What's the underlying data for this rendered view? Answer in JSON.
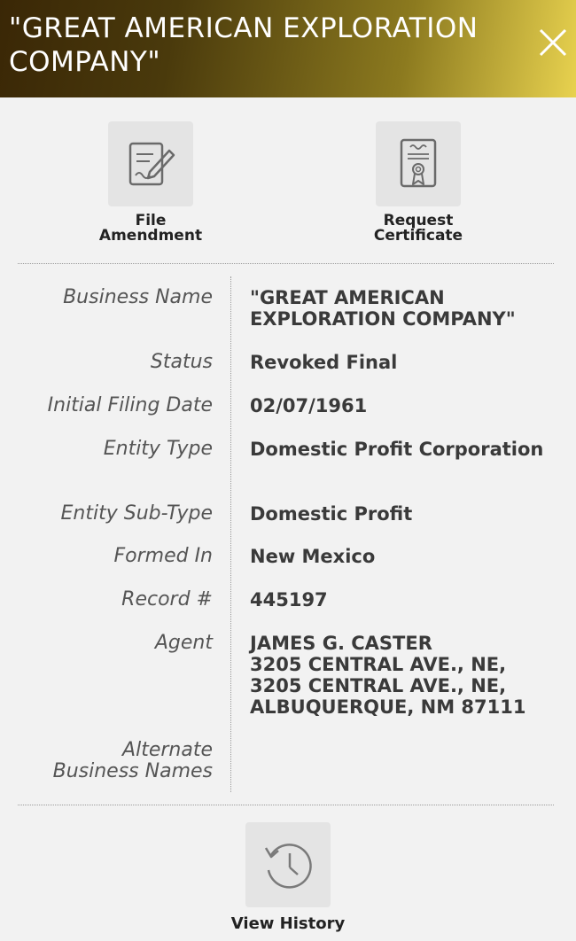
{
  "header": {
    "title": "\"GREAT AMERICAN EXPLORATION COMPANY\"",
    "close_icon": "close-icon"
  },
  "actions": {
    "file_amendment": {
      "label_line1": "File",
      "label_line2": "Amendment",
      "icon": "document-edit-icon"
    },
    "request_certificate": {
      "label_line1": "Request",
      "label_line2": "Certificate",
      "icon": "certificate-icon"
    }
  },
  "details": {
    "business_name": {
      "label": "Business Name",
      "value": "\"GREAT AMERICAN EXPLORATION COMPANY\""
    },
    "status": {
      "label": "Status",
      "value": "Revoked Final"
    },
    "initial_filing_date": {
      "label": "Initial Filing Date",
      "value": "02/07/1961"
    },
    "entity_type": {
      "label": "Entity Type",
      "value": "Domestic Profit Corporation"
    },
    "entity_sub_type": {
      "label": "Entity Sub-Type",
      "value": "Domestic Profit"
    },
    "formed_in": {
      "label": "Formed In",
      "value": "New Mexico"
    },
    "record_number": {
      "label": "Record #",
      "value": "445197"
    },
    "agent": {
      "label": "Agent",
      "lines": [
        "JAMES G. CASTER",
        "3205 CENTRAL AVE., NE,",
        "3205 CENTRAL AVE., NE,",
        "ALBUQUERQUE, NM 87111"
      ]
    },
    "alternate_business_names": {
      "label_line1": "Alternate",
      "label_line2": "Business Names",
      "value": ""
    }
  },
  "history": {
    "label": "View History",
    "icon": "history-icon"
  },
  "colors": {
    "header_dark": "#3a2706",
    "header_light": "#e8d24f",
    "background": "#f2f2f2",
    "tile": "#e4e4e4"
  }
}
